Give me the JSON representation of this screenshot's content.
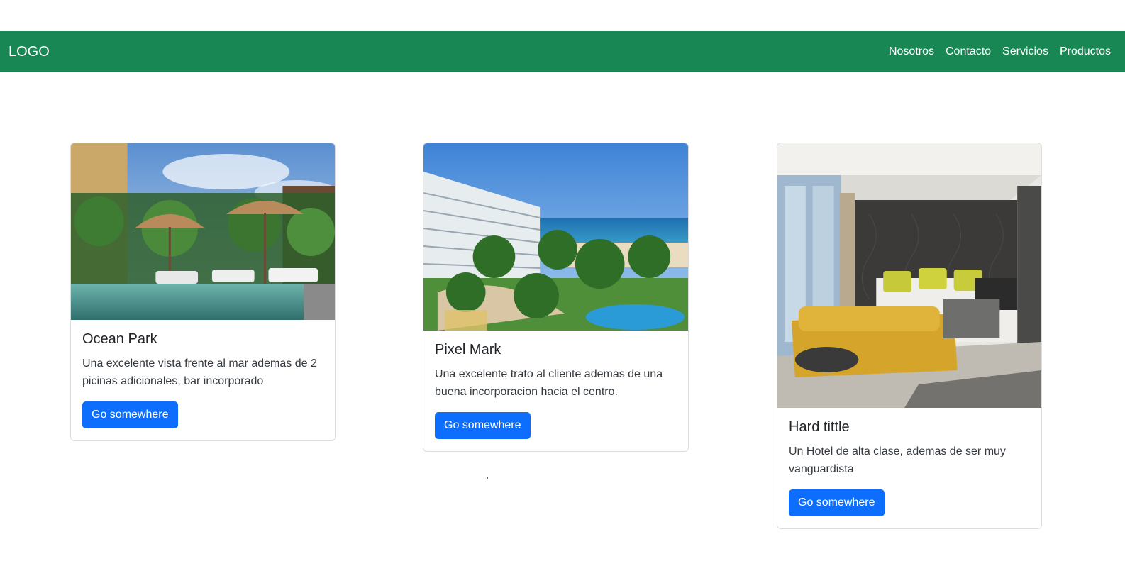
{
  "theme": {
    "navbar_bg": "#198754",
    "button_bg": "#0d6efd"
  },
  "navbar": {
    "logo": "LOGO",
    "links": [
      "Nosotros",
      "Contacto",
      "Servicios",
      "Productos"
    ]
  },
  "cards": [
    {
      "title": "Ocean Park",
      "text": "Una excelente vista frente al mar ademas de 2 picinas adicionales, bar incorporado",
      "button": "Go somewhere"
    },
    {
      "title": "Pixel Mark",
      "text": "Una excelente trato al cliente ademas de una buena incorporacion hacia el centro.",
      "button": "Go somewhere"
    },
    {
      "title": "Hard tittle",
      "text": "Un Hotel de alta clase, ademas de ser muy vanguardista",
      "button": "Go somewhere"
    }
  ]
}
